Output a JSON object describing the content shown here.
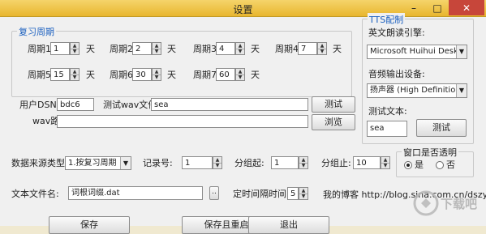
{
  "window": {
    "title": "设置",
    "minimize": "–",
    "maximize": "□",
    "close": "✕"
  },
  "review": {
    "group_title": "复习周期",
    "unit": "天",
    "rows": [
      {
        "label": "周期1",
        "value": "1"
      },
      {
        "label": "周期2",
        "value": "2"
      },
      {
        "label": "周期3",
        "value": "4"
      },
      {
        "label": "周期4",
        "value": "7"
      },
      {
        "label": "周期5",
        "value": "15"
      },
      {
        "label": "周期6",
        "value": "30"
      },
      {
        "label": "周期7",
        "value": "60"
      }
    ]
  },
  "tts": {
    "group_title": "TTS配制",
    "engine_label": "英文朗读引擎:",
    "engine_value": "Microsoft Huihui Desktop - Chi",
    "output_label": "音频输出设备:",
    "output_value": "扬声器 (High Definition Audio",
    "test_text_label": "测试文本:",
    "test_text_value": "sea",
    "test_button": "测试"
  },
  "user": {
    "dsn_label": "用户DSN",
    "dsn_value": "bdc6",
    "wav_test_label": "测试wav文件",
    "wav_test_value": "sea",
    "test_button": "测试",
    "wav_path_label": "wav路径",
    "wav_path_value": "",
    "browse_button": "浏览"
  },
  "source": {
    "type_label": "数据来源类型:",
    "type_value": "1.按复习周期",
    "record_label": "记录号:",
    "record_value": "1",
    "group_start_label": "分组起:",
    "group_start_value": "1",
    "group_end_label": "分组止:",
    "group_end_value": "10"
  },
  "transparent": {
    "group_title": "窗口是否透明",
    "yes": "是",
    "no": "否"
  },
  "file": {
    "label": "文本文件名:",
    "value": "词根词缀.dat",
    "browse": "..",
    "interval_label": "定时间隔时间:",
    "interval_value": "5"
  },
  "blog": {
    "text": "我的博客 http://blog.sina.com.cn/dszyz"
  },
  "buttons": {
    "save": "保存",
    "save_restart": "保存且重启",
    "exit": "退出"
  },
  "watermark": {
    "text": "下载吧"
  }
}
